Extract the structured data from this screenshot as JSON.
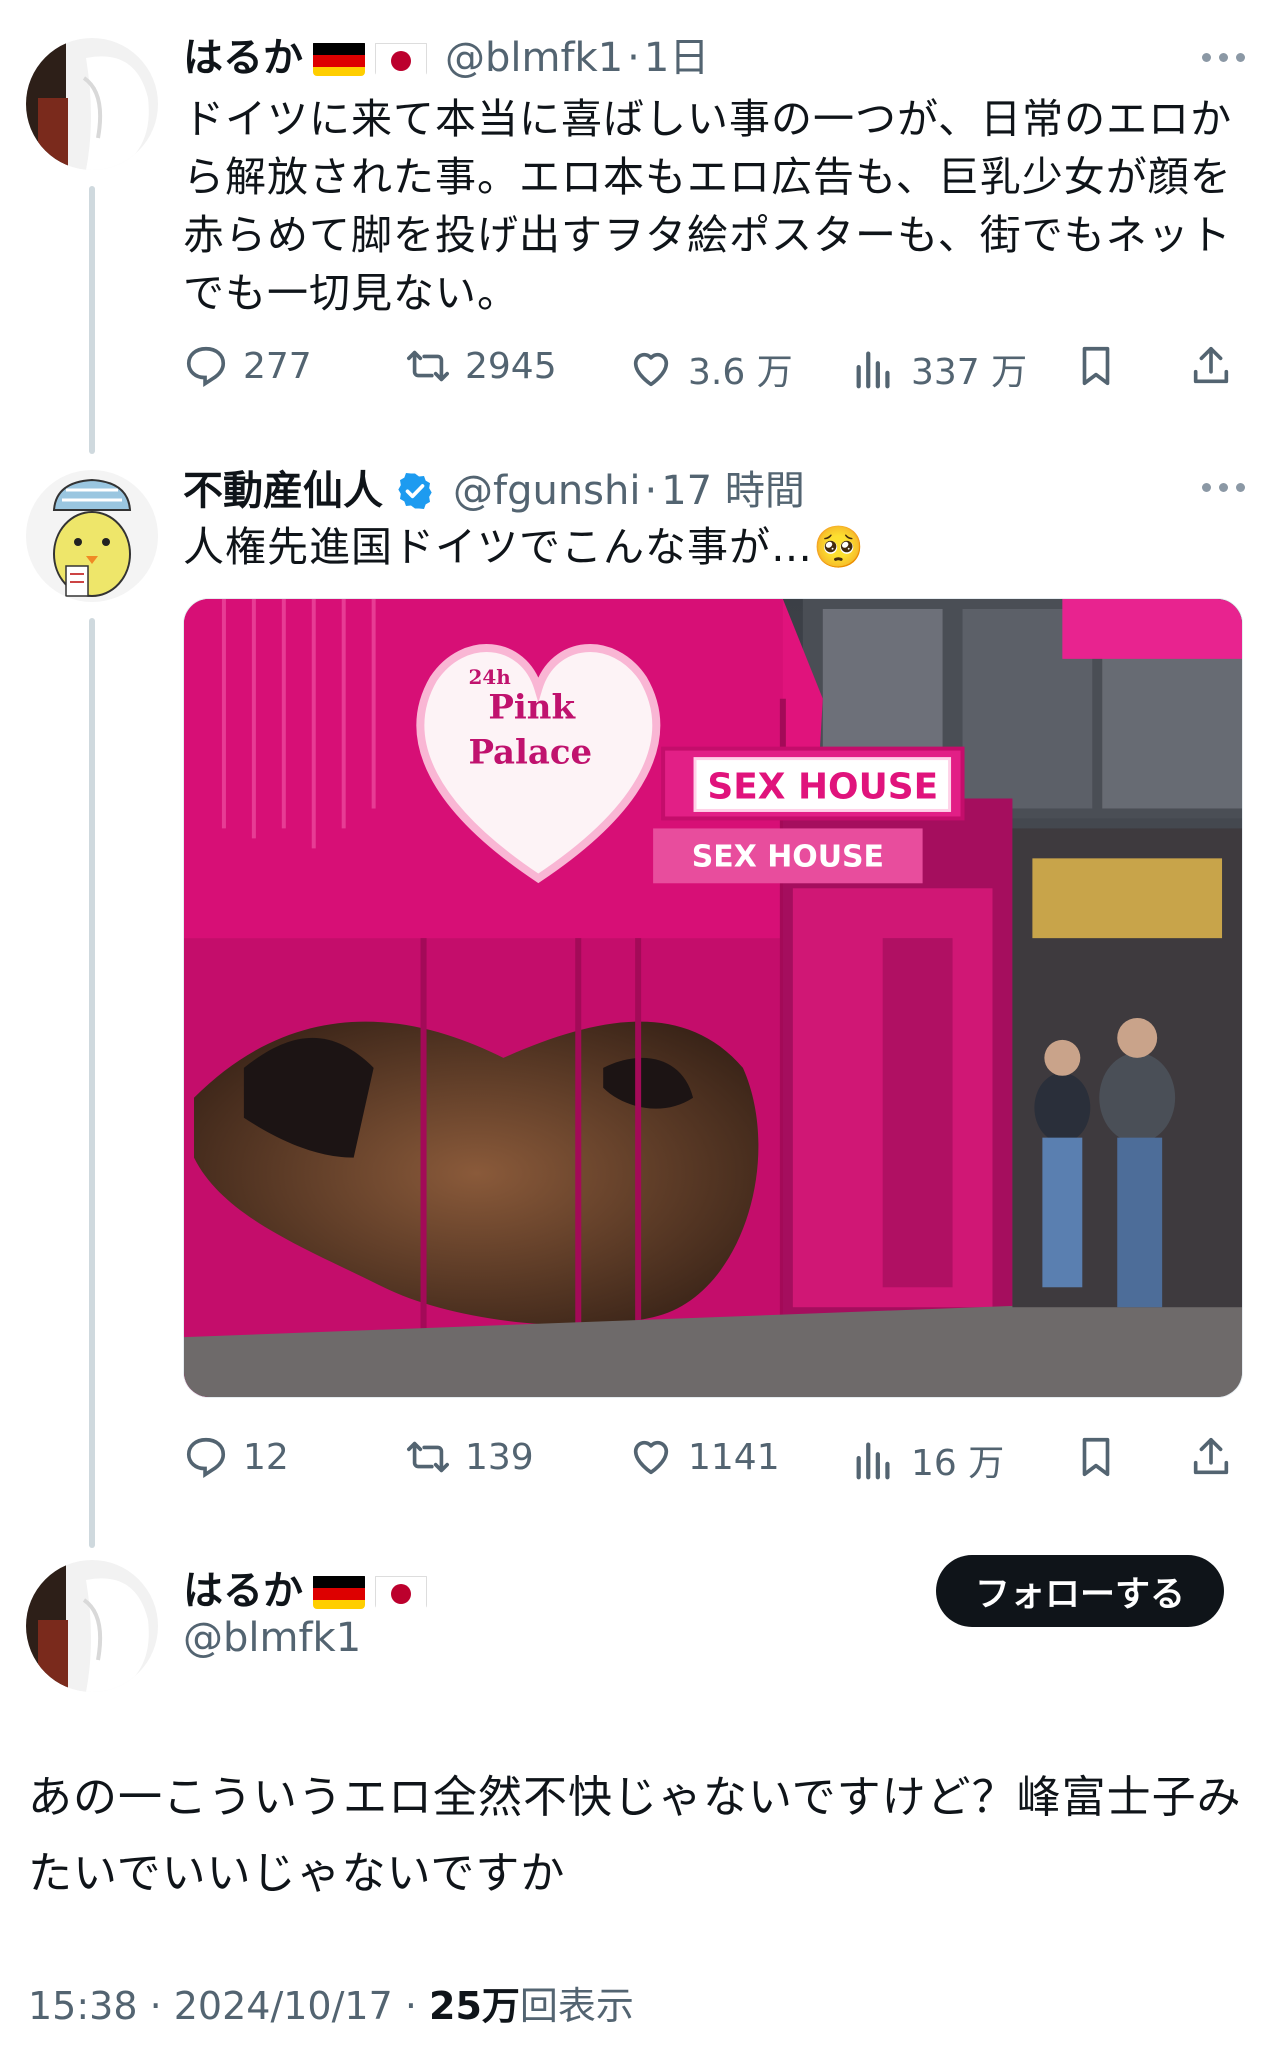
{
  "tweet1": {
    "name": "はるか",
    "flags": [
      "german-flag",
      "japanese-flag"
    ],
    "handle": "@blmfk1",
    "dot": "·",
    "time": "1日",
    "text": "ドイツに来て本当に喜ばしい事の一つが、日常のエロから解放された事。エロ本もエロ広告も、巨乳少女が顔を赤らめて脚を投げ出すヲタ絵ポスターも、街でもネットでも一切見ない。",
    "replies": "277",
    "retweets": "2945",
    "likes": "3.6 万",
    "views": "337 万"
  },
  "tweet2": {
    "name": "不動産仙人",
    "handle": "@fgunshi",
    "dot": "·",
    "time": "17 時間",
    "text": "人権先進国ドイツでこんな事が…🥺",
    "replies": "12",
    "retweets": "139",
    "likes": "1141",
    "views": "16 万",
    "image_signs": {
      "heart_sign_top": "24h",
      "heart_sign_line1": "Pink",
      "heart_sign_line2": "Palace",
      "neon_sign_main": "SEX HOUSE",
      "neon_sign_small": "SEX HOUSE"
    }
  },
  "main_tweet": {
    "name": "はるか",
    "handle": "@blmfk1",
    "follow_label": "フォローする",
    "text": "あの一こういうエロ全然不快じゃないですけど？峰富士子みたいでいいじゃないですか",
    "timestamp": "15:38 · 2024/10/17 · ",
    "view_count": "25万",
    "view_suffix": "回表示"
  },
  "colors": {
    "text_primary": "#0f1419",
    "text_secondary": "#536471",
    "verified_blue": "#1d9bf0",
    "thread_line": "#cfd9de",
    "pink": "#e5007e"
  }
}
